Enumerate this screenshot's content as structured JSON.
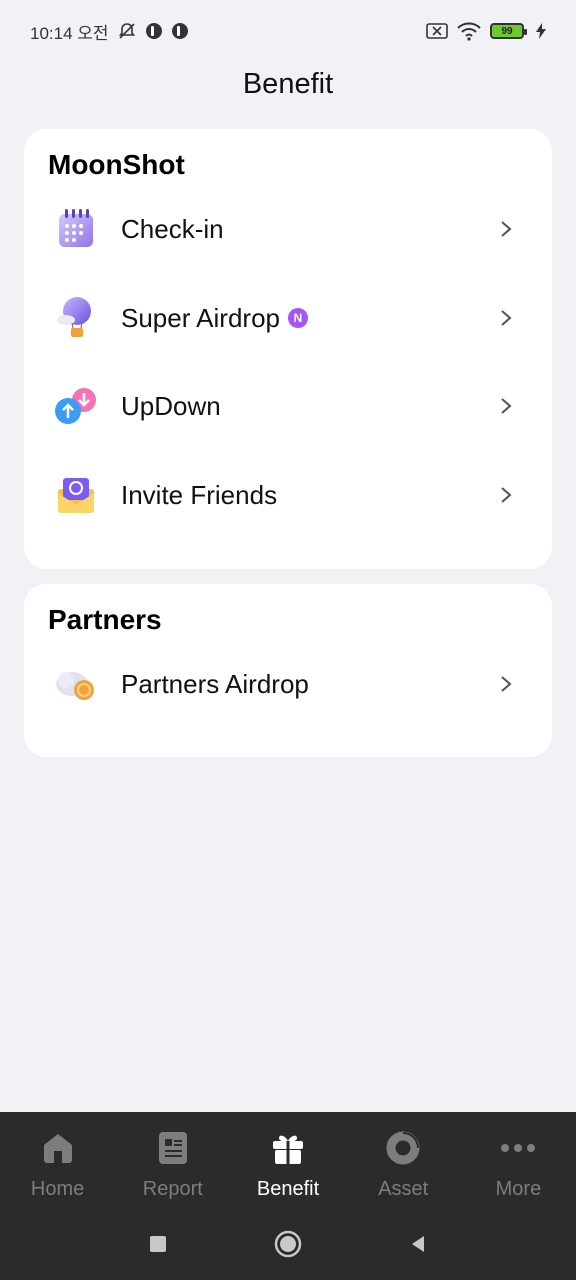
{
  "status_bar": {
    "time": "10:14 오전",
    "battery": "99",
    "icons": [
      "notifications-off-icon",
      "app-badge-icon",
      "app-badge-icon",
      "sim-off-icon",
      "wifi-icon",
      "battery-icon",
      "charging-icon"
    ]
  },
  "header": {
    "title": "Benefit"
  },
  "sections": [
    {
      "heading": "MoonShot",
      "items": [
        {
          "label": "Check-in",
          "icon": "calendar-icon"
        },
        {
          "label": "Super Airdrop",
          "icon": "hot-air-balloon-icon",
          "badge": "N"
        },
        {
          "label": "UpDown",
          "icon": "updown-arrows-icon"
        },
        {
          "label": "Invite Friends",
          "icon": "envelope-icon"
        }
      ]
    },
    {
      "heading": "Partners",
      "items": [
        {
          "label": "Partners Airdrop",
          "icon": "cloud-coin-icon"
        }
      ]
    }
  ],
  "bottom_nav": {
    "items": [
      {
        "label": "Home",
        "icon": "home-icon"
      },
      {
        "label": "Report",
        "icon": "report-icon"
      },
      {
        "label": "Benefit",
        "icon": "gift-icon",
        "active": true
      },
      {
        "label": "Asset",
        "icon": "donut-chart-icon"
      },
      {
        "label": "More",
        "icon": "more-dots-icon"
      }
    ]
  },
  "colors": {
    "background": "#F1F2F5",
    "card": "#FFFFFF",
    "nav_bg": "#2B2B2B",
    "nav_active": "#FFFFFF",
    "nav_inactive": "#7D7D7D",
    "badge": "#A855F7"
  }
}
